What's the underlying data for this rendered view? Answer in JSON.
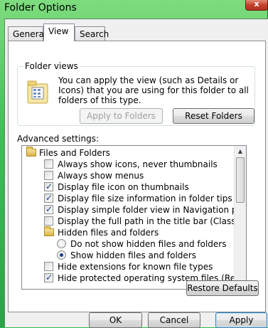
{
  "window": {
    "title": "Folder Options",
    "close_label": "x"
  },
  "tabs": [
    {
      "label": "General",
      "selected": false
    },
    {
      "label": "View",
      "selected": true
    },
    {
      "label": "Search",
      "selected": false
    }
  ],
  "folder_views": {
    "title": "Folder views",
    "description": "You can apply the view (such as Details or Icons) that you are using for this folder to all folders of this type.",
    "apply_button": "Apply to Folders",
    "reset_button": "Reset Folders",
    "icon": "folder-view-icon"
  },
  "advanced": {
    "label": "Advanced settings:",
    "items": [
      {
        "type": "folder",
        "label": "Files and Folders",
        "level": 0
      },
      {
        "type": "checkbox",
        "label": "Always show icons, never thumbnails",
        "checked": false,
        "level": 1
      },
      {
        "type": "checkbox",
        "label": "Always show menus",
        "checked": false,
        "level": 1
      },
      {
        "type": "checkbox",
        "label": "Display file icon on thumbnails",
        "checked": true,
        "level": 1
      },
      {
        "type": "checkbox",
        "label": "Display file size information in folder tips",
        "checked": true,
        "level": 1
      },
      {
        "type": "checkbox",
        "label": "Display simple folder view in Navigation pane",
        "checked": true,
        "level": 1
      },
      {
        "type": "checkbox",
        "label": "Display the full path in the title bar (Classic folders only)",
        "checked": false,
        "level": 1
      },
      {
        "type": "folder",
        "label": "Hidden files and folders",
        "level": 1
      },
      {
        "type": "radio",
        "label": "Do not show hidden files and folders",
        "checked": false,
        "level": 2
      },
      {
        "type": "radio",
        "label": "Show hidden files and folders",
        "checked": true,
        "level": 2
      },
      {
        "type": "checkbox",
        "label": "Hide extensions for known file types",
        "checked": false,
        "level": 1
      },
      {
        "type": "checkbox",
        "label": "Hide protected operating system files (Recommended)",
        "checked": true,
        "level": 1
      }
    ]
  },
  "buttons": {
    "restore": "Restore Defaults",
    "ok": "OK",
    "cancel": "Cancel",
    "apply": "Apply"
  }
}
